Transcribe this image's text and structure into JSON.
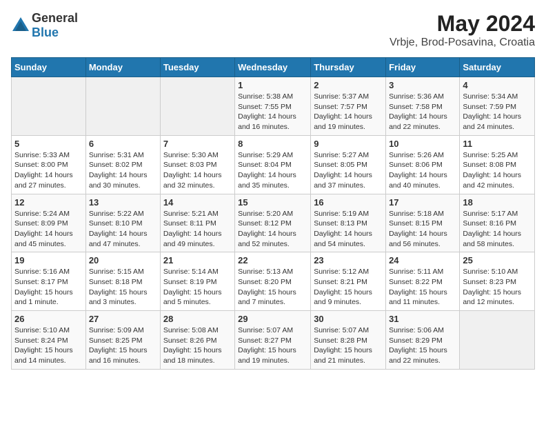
{
  "logo": {
    "general": "General",
    "blue": "Blue"
  },
  "title": "May 2024",
  "subtitle": "Vrbje, Brod-Posavina, Croatia",
  "weekdays": [
    "Sunday",
    "Monday",
    "Tuesday",
    "Wednesday",
    "Thursday",
    "Friday",
    "Saturday"
  ],
  "weeks": [
    [
      {
        "day": "",
        "info": ""
      },
      {
        "day": "",
        "info": ""
      },
      {
        "day": "",
        "info": ""
      },
      {
        "day": "1",
        "info": "Sunrise: 5:38 AM\nSunset: 7:55 PM\nDaylight: 14 hours and 16 minutes."
      },
      {
        "day": "2",
        "info": "Sunrise: 5:37 AM\nSunset: 7:57 PM\nDaylight: 14 hours and 19 minutes."
      },
      {
        "day": "3",
        "info": "Sunrise: 5:36 AM\nSunset: 7:58 PM\nDaylight: 14 hours and 22 minutes."
      },
      {
        "day": "4",
        "info": "Sunrise: 5:34 AM\nSunset: 7:59 PM\nDaylight: 14 hours and 24 minutes."
      }
    ],
    [
      {
        "day": "5",
        "info": "Sunrise: 5:33 AM\nSunset: 8:00 PM\nDaylight: 14 hours and 27 minutes."
      },
      {
        "day": "6",
        "info": "Sunrise: 5:31 AM\nSunset: 8:02 PM\nDaylight: 14 hours and 30 minutes."
      },
      {
        "day": "7",
        "info": "Sunrise: 5:30 AM\nSunset: 8:03 PM\nDaylight: 14 hours and 32 minutes."
      },
      {
        "day": "8",
        "info": "Sunrise: 5:29 AM\nSunset: 8:04 PM\nDaylight: 14 hours and 35 minutes."
      },
      {
        "day": "9",
        "info": "Sunrise: 5:27 AM\nSunset: 8:05 PM\nDaylight: 14 hours and 37 minutes."
      },
      {
        "day": "10",
        "info": "Sunrise: 5:26 AM\nSunset: 8:06 PM\nDaylight: 14 hours and 40 minutes."
      },
      {
        "day": "11",
        "info": "Sunrise: 5:25 AM\nSunset: 8:08 PM\nDaylight: 14 hours and 42 minutes."
      }
    ],
    [
      {
        "day": "12",
        "info": "Sunrise: 5:24 AM\nSunset: 8:09 PM\nDaylight: 14 hours and 45 minutes."
      },
      {
        "day": "13",
        "info": "Sunrise: 5:22 AM\nSunset: 8:10 PM\nDaylight: 14 hours and 47 minutes."
      },
      {
        "day": "14",
        "info": "Sunrise: 5:21 AM\nSunset: 8:11 PM\nDaylight: 14 hours and 49 minutes."
      },
      {
        "day": "15",
        "info": "Sunrise: 5:20 AM\nSunset: 8:12 PM\nDaylight: 14 hours and 52 minutes."
      },
      {
        "day": "16",
        "info": "Sunrise: 5:19 AM\nSunset: 8:13 PM\nDaylight: 14 hours and 54 minutes."
      },
      {
        "day": "17",
        "info": "Sunrise: 5:18 AM\nSunset: 8:15 PM\nDaylight: 14 hours and 56 minutes."
      },
      {
        "day": "18",
        "info": "Sunrise: 5:17 AM\nSunset: 8:16 PM\nDaylight: 14 hours and 58 minutes."
      }
    ],
    [
      {
        "day": "19",
        "info": "Sunrise: 5:16 AM\nSunset: 8:17 PM\nDaylight: 15 hours and 1 minute."
      },
      {
        "day": "20",
        "info": "Sunrise: 5:15 AM\nSunset: 8:18 PM\nDaylight: 15 hours and 3 minutes."
      },
      {
        "day": "21",
        "info": "Sunrise: 5:14 AM\nSunset: 8:19 PM\nDaylight: 15 hours and 5 minutes."
      },
      {
        "day": "22",
        "info": "Sunrise: 5:13 AM\nSunset: 8:20 PM\nDaylight: 15 hours and 7 minutes."
      },
      {
        "day": "23",
        "info": "Sunrise: 5:12 AM\nSunset: 8:21 PM\nDaylight: 15 hours and 9 minutes."
      },
      {
        "day": "24",
        "info": "Sunrise: 5:11 AM\nSunset: 8:22 PM\nDaylight: 15 hours and 11 minutes."
      },
      {
        "day": "25",
        "info": "Sunrise: 5:10 AM\nSunset: 8:23 PM\nDaylight: 15 hours and 12 minutes."
      }
    ],
    [
      {
        "day": "26",
        "info": "Sunrise: 5:10 AM\nSunset: 8:24 PM\nDaylight: 15 hours and 14 minutes."
      },
      {
        "day": "27",
        "info": "Sunrise: 5:09 AM\nSunset: 8:25 PM\nDaylight: 15 hours and 16 minutes."
      },
      {
        "day": "28",
        "info": "Sunrise: 5:08 AM\nSunset: 8:26 PM\nDaylight: 15 hours and 18 minutes."
      },
      {
        "day": "29",
        "info": "Sunrise: 5:07 AM\nSunset: 8:27 PM\nDaylight: 15 hours and 19 minutes."
      },
      {
        "day": "30",
        "info": "Sunrise: 5:07 AM\nSunset: 8:28 PM\nDaylight: 15 hours and 21 minutes."
      },
      {
        "day": "31",
        "info": "Sunrise: 5:06 AM\nSunset: 8:29 PM\nDaylight: 15 hours and 22 minutes."
      },
      {
        "day": "",
        "info": ""
      }
    ]
  ]
}
